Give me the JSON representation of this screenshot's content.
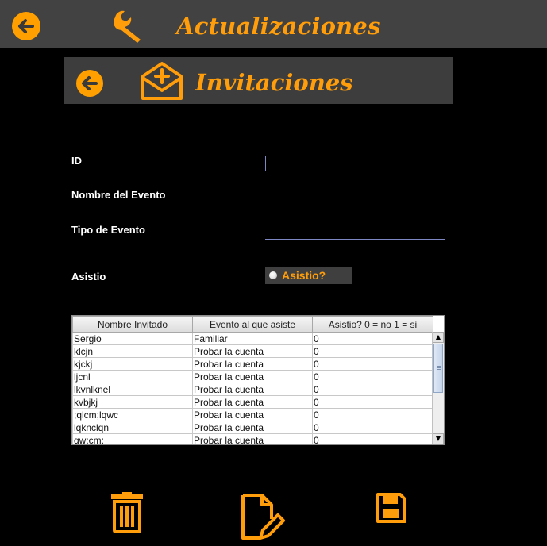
{
  "header": {
    "title": "Actualizaciones",
    "back_icon": "back-arrow-icon",
    "tool_icon": "wrench-icon"
  },
  "subheader": {
    "title": "Invitaciones",
    "back_icon": "back-arrow-icon",
    "mail_icon": "mail-add-icon"
  },
  "form": {
    "id_label": "ID",
    "evento_label": "Nombre del Evento",
    "tipo_label": "Tipo de Evento",
    "asistio_label": "Asistio",
    "id_value": "",
    "evento_value": "",
    "tipo_value": "",
    "radio_label": "Asistio?"
  },
  "table": {
    "columns": [
      "Nombre Invitado",
      "Evento al que asiste",
      "Asistio? 0 = no 1 = si"
    ],
    "rows": [
      [
        "Sergio",
        " Familiar",
        "0"
      ],
      [
        "klcjn",
        "Probar la cuenta",
        "0"
      ],
      [
        "kjckj",
        "Probar la cuenta",
        "0"
      ],
      [
        "ljcnl",
        "Probar la cuenta",
        "0"
      ],
      [
        "lkvnlknel",
        "Probar la cuenta",
        "0"
      ],
      [
        "kvbjkj",
        "Probar la cuenta",
        "0"
      ],
      [
        ";qlcm;lqwc",
        "Probar la cuenta",
        "0"
      ],
      [
        "lqknclqn",
        "Probar la cuenta",
        "0"
      ],
      [
        "qw;cm;",
        "Probar la cuenta",
        "0"
      ]
    ]
  },
  "actions": {
    "delete_icon": "trash-icon",
    "edit_icon": "edit-document-icon",
    "save_icon": "save-icon"
  },
  "colors": {
    "accent": "#ff9d0a",
    "bar": "#424242",
    "background": "#000000"
  }
}
